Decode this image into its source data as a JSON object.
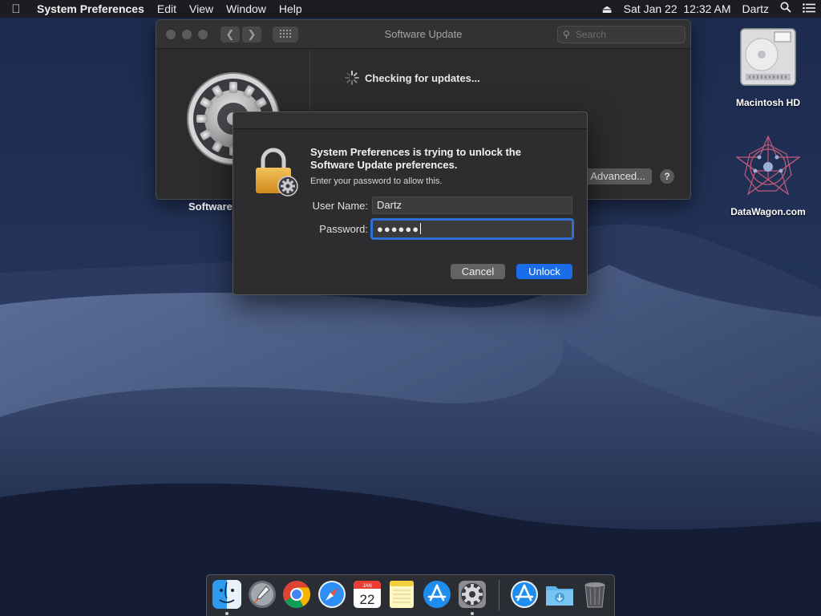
{
  "menubar": {
    "app_name": "System Preferences",
    "menus": [
      "Edit",
      "View",
      "Window",
      "Help"
    ],
    "date": "Sat Jan 22",
    "time": "12:32 AM",
    "user": "Dartz"
  },
  "software_update_window": {
    "title": "Software Update",
    "search_placeholder": "Search",
    "app_label": "Software",
    "status": "Checking for updates...",
    "advanced_label": "Advanced...",
    "help_label": "?"
  },
  "auth_dialog": {
    "heading_line1": "System Preferences is trying to unlock the",
    "heading_line2": "Software Update preferences.",
    "subtext": "Enter your password to allow this.",
    "username_label": "User Name:",
    "username_value": "Dartz",
    "password_label": "Password:",
    "password_masked": "●●●●●●",
    "cancel_label": "Cancel",
    "unlock_label": "Unlock"
  },
  "desktop_icons": [
    {
      "label": "Macintosh HD",
      "icon": "hard-drive-icon"
    },
    {
      "label": "DataWagon.com",
      "icon": "datawagon-logo-icon"
    }
  ],
  "dock": {
    "apps": [
      "finder",
      "launchpad",
      "chrome",
      "safari",
      "calendar",
      "notes",
      "app-store",
      "system-preferences",
      "app-store-2",
      "downloads-folder",
      "trash"
    ],
    "calendar_month": "JAN",
    "calendar_day": "22"
  },
  "colors": {
    "accent": "#1a6ce8",
    "focus_ring": "#2f6fd5",
    "window_bg": "#2c2c2e"
  }
}
